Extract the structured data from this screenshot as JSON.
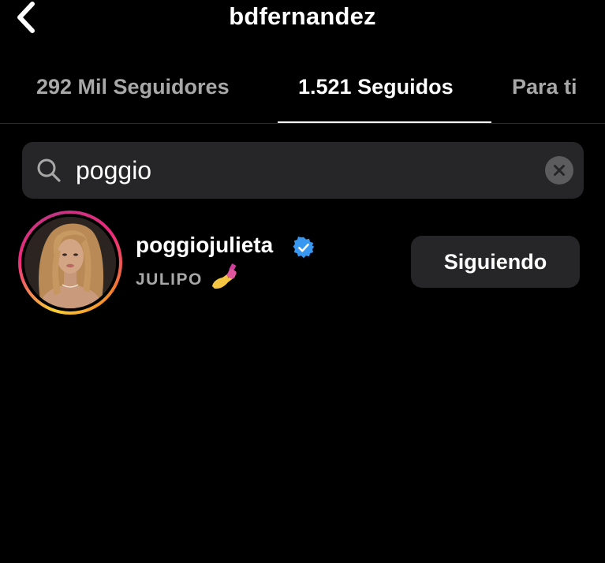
{
  "header": {
    "title": "bdfernandez",
    "back_icon": "chevron-left-icon"
  },
  "tabs": [
    {
      "label": "292 Mil Seguidores",
      "active": false
    },
    {
      "label": "1.521 Seguidos",
      "active": true
    },
    {
      "label": "Para ti",
      "active": false
    }
  ],
  "search": {
    "value": "poggio",
    "icon": "search-icon",
    "clear_icon": "clear-icon"
  },
  "results": [
    {
      "username": "poggiojulieta",
      "verified": true,
      "full_name": "JULIPO",
      "name_emoji": "nail-polish-emoji",
      "button_label": "Siguiendo"
    }
  ],
  "colors": {
    "background": "#000000",
    "text_primary": "#ffffff",
    "text_secondary": "#a8a8a8",
    "surface": "#262628",
    "verified_blue": "#3897f0"
  }
}
